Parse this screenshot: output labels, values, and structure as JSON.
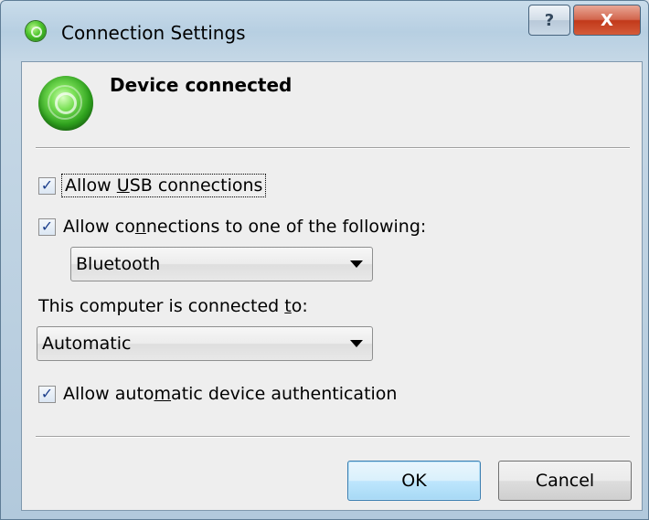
{
  "window": {
    "title": "Connection Settings"
  },
  "caption_buttons": {
    "help": "?",
    "close": "X"
  },
  "status": {
    "heading": "Device connected"
  },
  "options": {
    "allow_usb_prefix": "Allow ",
    "allow_usb_accel": "U",
    "allow_usb_suffix": "SB connections",
    "allow_usb_checked": true,
    "allow_conn_prefix": "Allow co",
    "allow_conn_accel": "n",
    "allow_conn_suffix": "nections to one of the following:",
    "allow_conn_checked": true,
    "connection_type": "Bluetooth",
    "connected_to_prefix": "This computer is connected ",
    "connected_to_accel": "t",
    "connected_to_suffix": "o:",
    "connected_to_value": "Automatic",
    "auto_auth_prefix": "Allow auto",
    "auto_auth_accel": "m",
    "auto_auth_suffix": "atic device authentication",
    "auto_auth_checked": true
  },
  "buttons": {
    "ok": "OK",
    "cancel": "Cancel"
  },
  "glyphs": {
    "check": "✓"
  }
}
